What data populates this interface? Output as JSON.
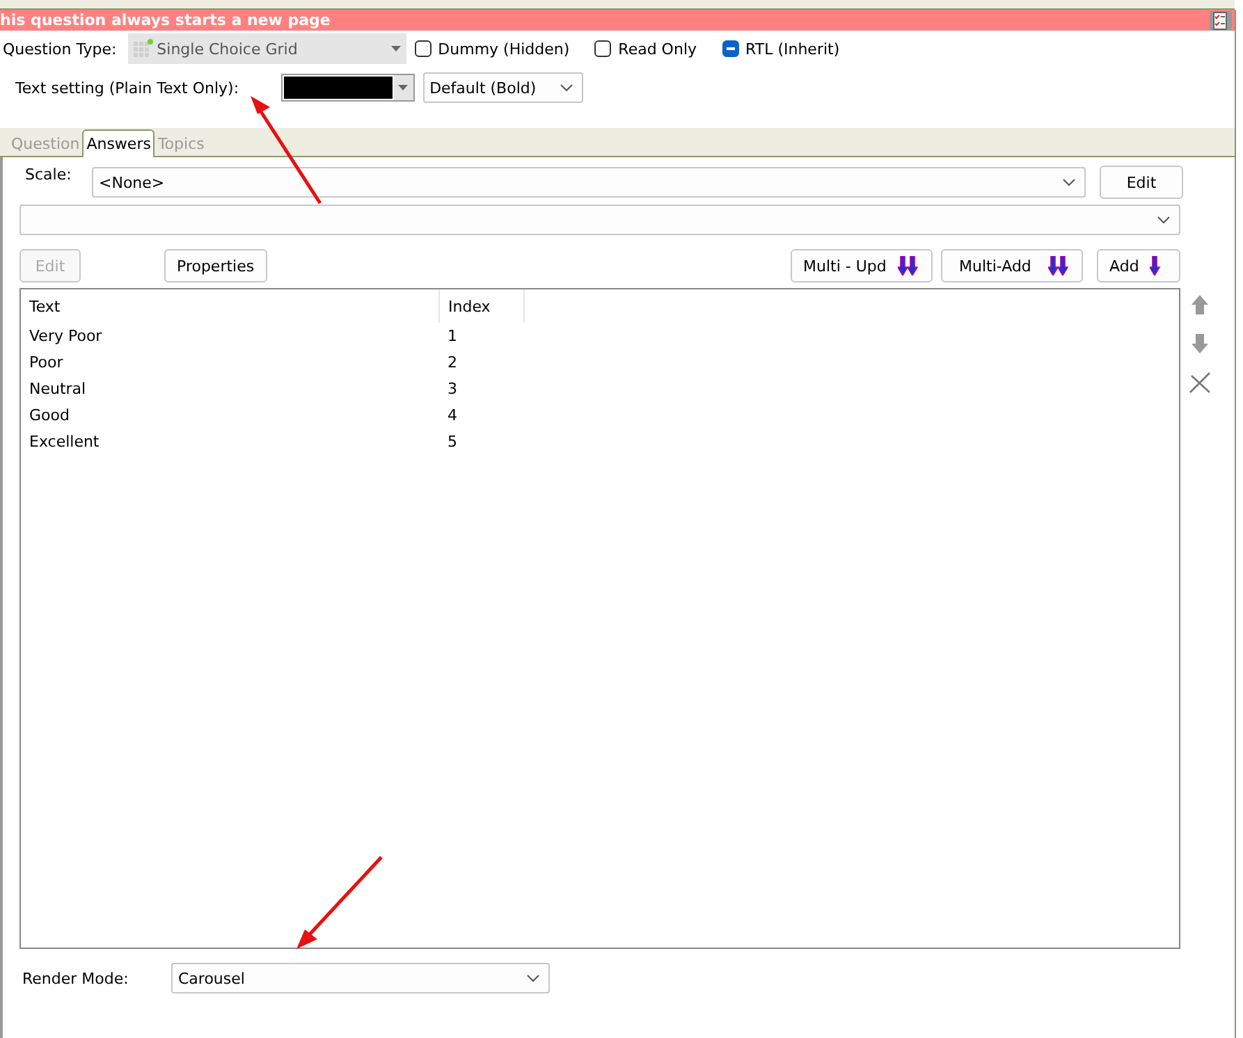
{
  "banner": {
    "text": "his question always starts a new page"
  },
  "question_type": {
    "label": "Question Type:",
    "value": "Single Choice Grid"
  },
  "checkboxes": [
    {
      "label": "Dummy (Hidden)",
      "indeterminate": false
    },
    {
      "label": "Read Only",
      "indeterminate": false
    },
    {
      "label": "RTL (Inherit)",
      "indeterminate": true
    }
  ],
  "text_setting": {
    "label": "Text setting (Plain Text Only):",
    "style": "Default (Bold)"
  },
  "tabs": [
    {
      "label": "Question",
      "selected": false
    },
    {
      "label": "Answers",
      "selected": true
    },
    {
      "label": "Topics",
      "selected": false
    }
  ],
  "scale": {
    "label": "Scale:",
    "value": "<None>",
    "button": "Edit"
  },
  "toolbar": [
    {
      "label": "Edit",
      "disabled": true,
      "kind": "plain"
    },
    {
      "label": "Properties",
      "disabled": false,
      "kind": "plain"
    },
    {
      "label": "Multi - Upd",
      "disabled": false,
      "kind": "double"
    },
    {
      "label": "Multi-Add",
      "disabled": false,
      "kind": "double"
    },
    {
      "label": "Add",
      "disabled": false,
      "kind": "single"
    }
  ],
  "table": {
    "columns": [
      "Text",
      "Index"
    ],
    "rows": [
      [
        "Very Poor",
        "1"
      ],
      [
        "Poor",
        "2"
      ],
      [
        "Neutral",
        "3"
      ],
      [
        "Good",
        "4"
      ],
      [
        "Excellent",
        "5"
      ]
    ]
  },
  "render_mode": {
    "label": "Render Mode:",
    "value": "Carousel"
  }
}
